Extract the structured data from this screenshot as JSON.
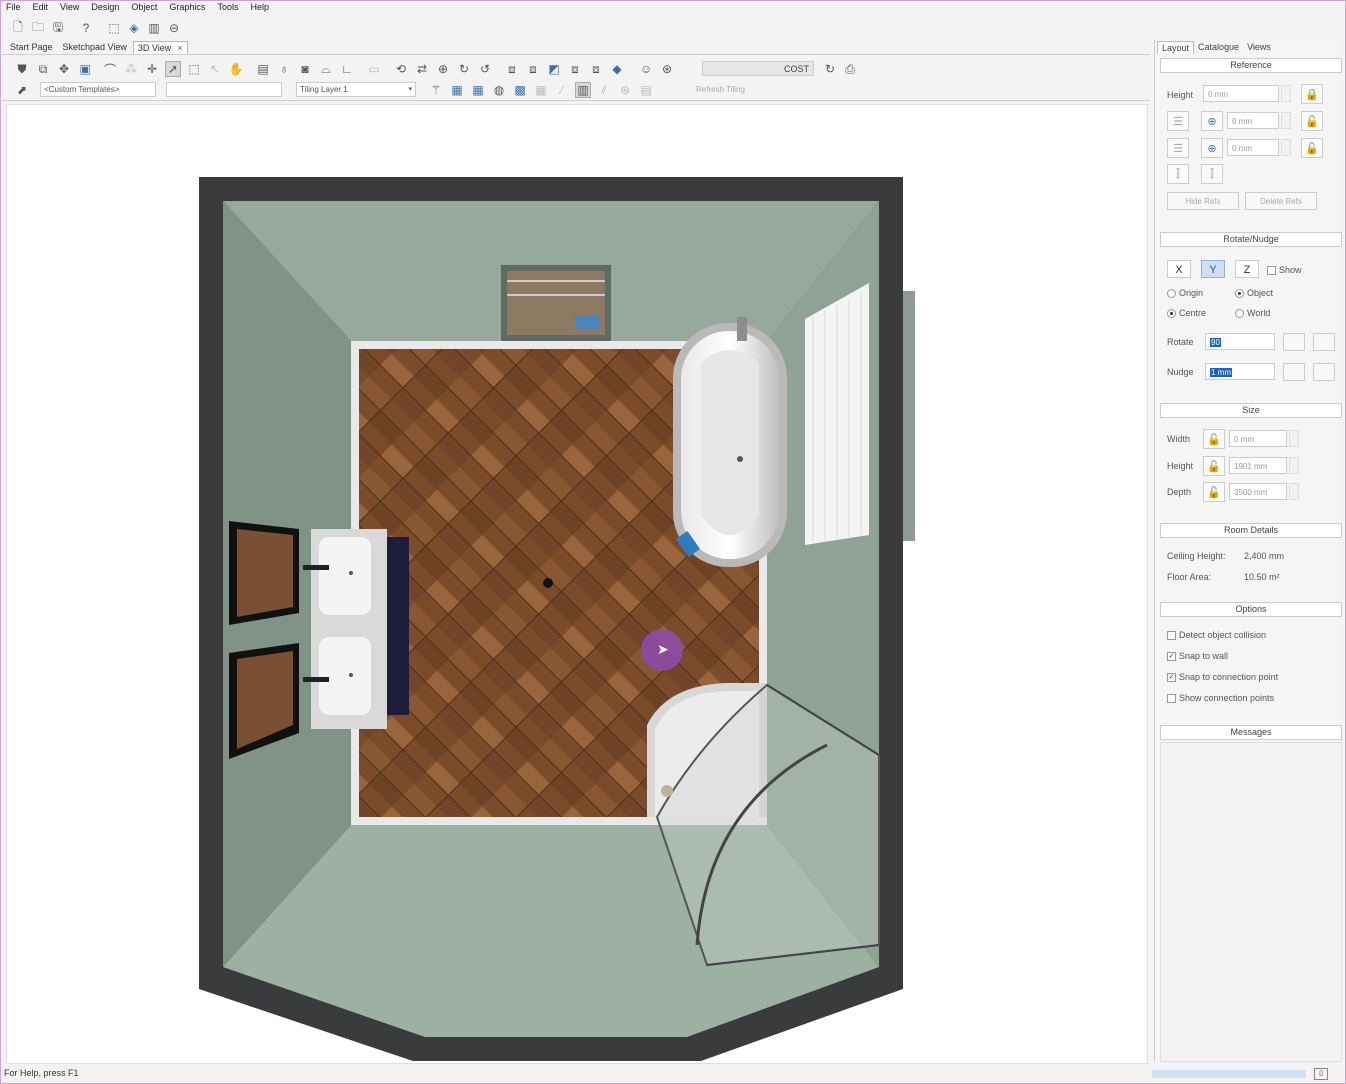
{
  "menu": [
    "File",
    "Edit",
    "View",
    "Design",
    "Object",
    "Graphics",
    "Tools",
    "Help"
  ],
  "tabs": {
    "start": "Start Page",
    "sketch": "Sketchpad View",
    "view3d": "3D View",
    "close": "×"
  },
  "toolbar": {
    "templates": "<Custom Templates>",
    "tiling_layer": "Tiling Layer 1",
    "cost": "COST",
    "refresh_tiling": "Refresh Tiling"
  },
  "right_panel": {
    "tabs": [
      "Layout",
      "Catalogue",
      "Views"
    ],
    "reference": {
      "title": "Reference",
      "height_label": "Height",
      "height_value": "0 mm",
      "val2": "0 mm",
      "val3": "0 mm",
      "hide_refs": "Hide Refs",
      "delete_refs": "Delete Refs"
    },
    "rotate": {
      "title": "Rotate/Nudge",
      "x": "X",
      "y": "Y",
      "z": "Z",
      "show": "Show",
      "origin": "Origin",
      "object": "Object",
      "centre": "Centre",
      "world": "World",
      "rotate_label": "Rotate",
      "rotate_value": "90",
      "nudge_label": "Nudge",
      "nudge_value": "1 mm"
    },
    "size": {
      "title": "Size",
      "width_label": "Width",
      "width_value": "0 mm",
      "height_label": "Height",
      "height_value": "1901 mm",
      "depth_label": "Depth",
      "depth_value": "3500 mm"
    },
    "room": {
      "title": "Room Details",
      "ceiling_label": "Ceiling Height:",
      "ceiling_value": "2,400 mm",
      "floor_label": "Floor Area:",
      "floor_value": "10.50 m²"
    },
    "options": {
      "title": "Options",
      "o1": "Detect object collision",
      "o2": "Snap to wall",
      "o3": "Snap to connection point",
      "o4": "Show connection points"
    },
    "messages": {
      "title": "Messages"
    }
  },
  "status": {
    "help": "For Help, press F1"
  },
  "colors": {
    "wall": "#3a3b3d",
    "inner_wall": "#8a9e92",
    "floor": "#7a4a2a",
    "accent": "#8e4aa6"
  }
}
